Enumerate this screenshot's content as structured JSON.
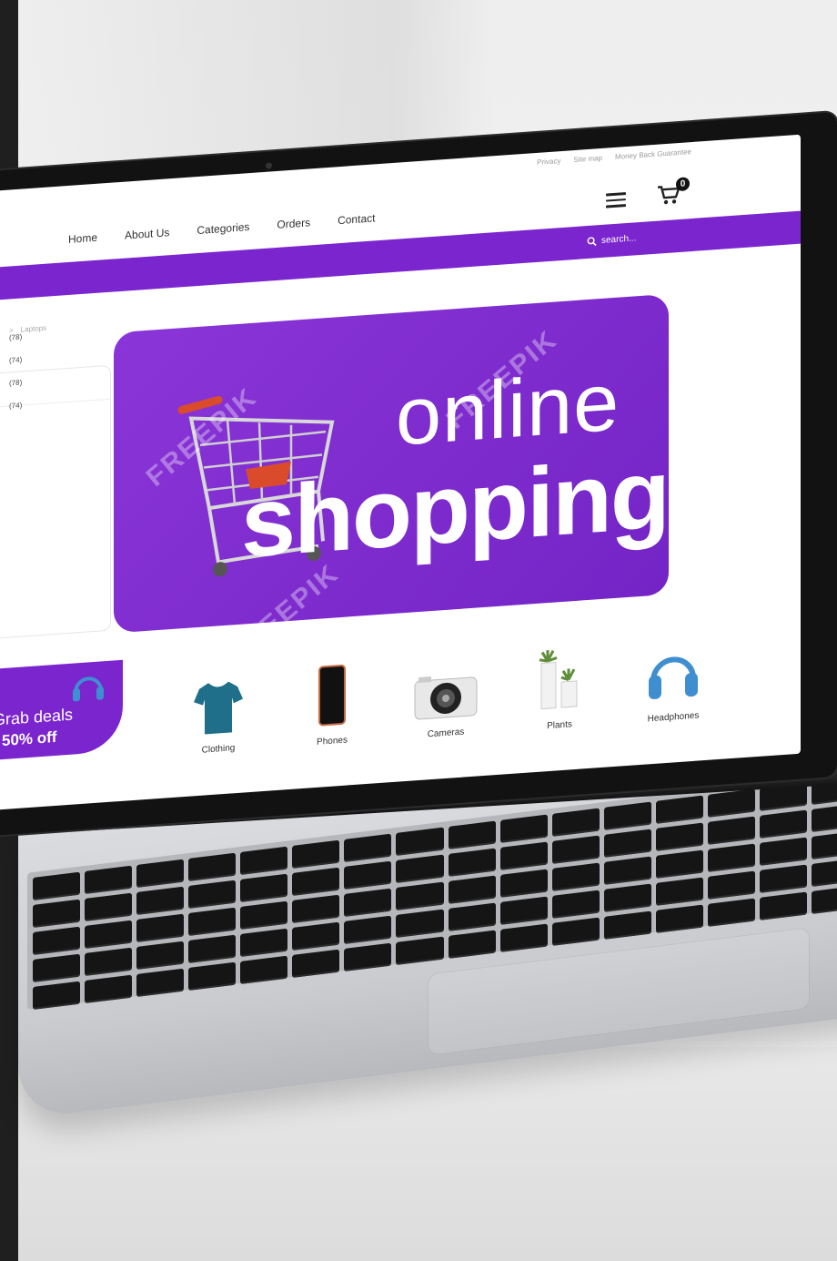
{
  "utility_links": [
    "Privacy",
    "Site map",
    "Money Back Guarantee"
  ],
  "nav": [
    "Home",
    "About Us",
    "Categories",
    "Orders",
    "Contact"
  ],
  "cart": {
    "icon": "cart-icon",
    "count": "0"
  },
  "menu_icon": "hamburger-icon",
  "search": {
    "icon": "search-icon",
    "placeholder": "search..."
  },
  "breadcrumb": {
    "current": "Laptops",
    "separator": ">"
  },
  "filter_counts": [
    "(78)",
    "(74)",
    "(78)",
    "(74)"
  ],
  "hero": {
    "line1": "online",
    "line2": "shopping"
  },
  "deals": {
    "line1": "Grab deals",
    "line2": "50% off"
  },
  "categories": [
    {
      "label": "Clothing",
      "icon": "tshirt-icon"
    },
    {
      "label": "Phones",
      "icon": "phone-icon"
    },
    {
      "label": "Cameras",
      "icon": "camera-icon"
    },
    {
      "label": "Plants",
      "icon": "plant-icon"
    },
    {
      "label": "Headphones",
      "icon": "headphones-icon"
    }
  ],
  "watermark": "FREEPIK",
  "colors": {
    "brand_purple": "#7b25cf",
    "cart_handle": "#d94b2b",
    "tshirt": "#1f6f8b",
    "headphones": "#3f8fd0"
  }
}
